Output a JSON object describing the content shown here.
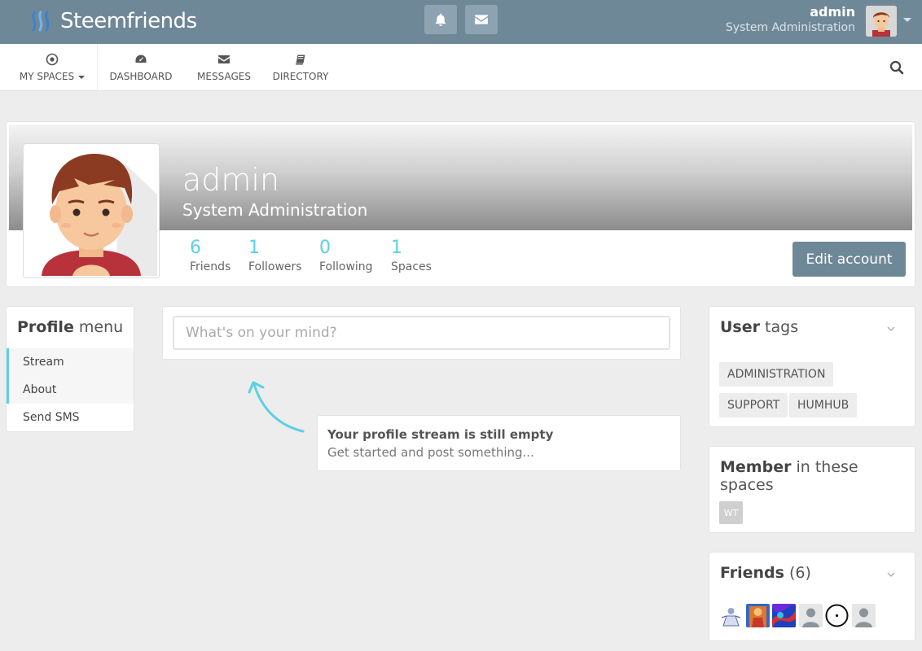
{
  "topbar": {
    "brand": "Steemfriends",
    "user_name": "admin",
    "user_title": "System Administration"
  },
  "nav": {
    "items": [
      {
        "label": "MY SPACES",
        "icon": "circle-dot-icon"
      },
      {
        "label": "DASHBOARD",
        "icon": "dashboard-gauge-icon"
      },
      {
        "label": "MESSAGES",
        "icon": "envelope-icon"
      },
      {
        "label": "DIRECTORY",
        "icon": "book-icon"
      }
    ]
  },
  "profile": {
    "name": "admin",
    "title": "System Administration",
    "stats": [
      {
        "value": "6",
        "label": "Friends"
      },
      {
        "value": "1",
        "label": "Followers"
      },
      {
        "value": "0",
        "label": "Following"
      },
      {
        "value": "1",
        "label": "Spaces"
      }
    ],
    "edit_label": "Edit account"
  },
  "profile_menu": {
    "title_bold": "Profile",
    "title_rest": " menu",
    "items": [
      "Stream",
      "About",
      "Send SMS"
    ]
  },
  "stream": {
    "placeholder": "What's on your mind?",
    "empty_title": "Your profile stream is still empty",
    "empty_sub": "Get started and post something..."
  },
  "user_tags": {
    "title_bold": "User",
    "title_rest": " tags",
    "tags": [
      "ADMINISTRATION",
      "SUPPORT",
      "HUMHUB"
    ]
  },
  "member_spaces": {
    "title_bold": "Member",
    "title_rest": " in these spaces",
    "spaces": [
      "WT"
    ]
  },
  "friends": {
    "title_bold": "Friends",
    "title_rest": " (6)"
  },
  "colors": {
    "header": "#6f8898",
    "accent": "#5ad1e6"
  }
}
